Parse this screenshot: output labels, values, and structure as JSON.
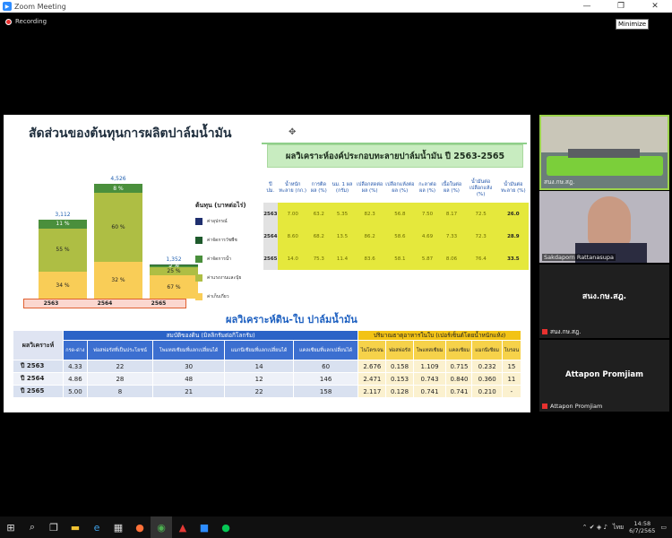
{
  "window": {
    "title": "Zoom Meeting",
    "recording": "Recording",
    "minimize_tip": "Minimize"
  },
  "slide": {
    "title": "สัดส่วนของต้นทุนการผลิตปาล์มน้ำมัน",
    "chart_data": {
      "type": "bar",
      "categories": [
        "2563",
        "2564",
        "2565"
      ],
      "totals": [
        "3,112",
        "4,526",
        "1,352"
      ],
      "legend_title": "ต้นทุน (บาทต่อไร่)",
      "series": [
        {
          "name": "ค่าเก็บเกี่ยว",
          "color": "#f9cd57",
          "values": [
            34,
            32,
            67
          ]
        },
        {
          "name": "ค่าแรงงานและปุ๋ย",
          "color": "#aebe44",
          "values": [
            55,
            60,
            25
          ]
        },
        {
          "name": "ค่าจัดการน้ำ",
          "color": "#4a8f3c",
          "values": [
            11,
            8,
            5
          ]
        },
        {
          "name": "ค่าจัดการวัชพืช",
          "color": "#1e5a2c",
          "values": [
            0,
            0,
            3
          ]
        },
        {
          "name": "ค่าอุปกรณ์",
          "color": "#1f2f6e",
          "values": [
            0,
            0,
            0
          ]
        }
      ]
    },
    "table1": {
      "title": "ผลวิเคราะห์องค์ประกอบทะลายปาล์มน้ำมัน ปี 2563-2565",
      "headers": [
        "ปี ปม.",
        "น้ำหนักทะลาย (กก.)",
        "การติดผล (%)",
        "นม. 1 ผล (กรัม)",
        "เปลือกสดต่อผล (%)",
        "เปลือกแห้งต่อผล (%)",
        "กะลาต่อผล (%)",
        "เนื้อในต่อผล (%)",
        "น้ำมันต่อเปลือกแห้ง (%)",
        "น้ำมันต่อทะลาย (%)"
      ],
      "rows": [
        [
          "2563",
          "7.00",
          "63.2",
          "5.35",
          "82.3",
          "56.8",
          "7.50",
          "8.17",
          "72.5",
          "26.0"
        ],
        [
          "2564",
          "8.60",
          "68.2",
          "13.5",
          "86.2",
          "58.6",
          "4.69",
          "7.33",
          "72.3",
          "28.9"
        ],
        [
          "2565",
          "14.0",
          "75.3",
          "11.4",
          "83.6",
          "58.1",
          "5.87",
          "8.06",
          "76.4",
          "33.5"
        ]
      ]
    },
    "table2": {
      "title": "ผลวิเคราะห์ดิน-ใบ ปาล์มน้ำมัน",
      "corner": "ผลวิเคราะห์",
      "group_soil": "สมบัติของดิน (มิลลิกรัมต่อกิโลกรัม)",
      "group_leaf": "ปริมาณธาตุอาหารในใบ (เปอร์เซ็นต์โดยน้ำหนักแห้ง)",
      "soil_headers": [
        "กรด-ด่าง",
        "ฟอสฟอรัสที่เป็นประโยชน์",
        "โพแทสเซียมที่แลกเปลี่ยนได้",
        "แมกนีเซียมที่แลกเปลี่ยนได้",
        "แคลเซียมที่แลกเปลี่ยนได้"
      ],
      "leaf_headers": [
        "ไนโตรเจน",
        "ฟอสฟอรัส",
        "โพแทสเซียม",
        "แคลเซียม",
        "แมกนีเซียม",
        "โบรอน"
      ],
      "rows": [
        [
          "ปี 2563",
          "4.33",
          "22",
          "30",
          "14",
          "60",
          "2.676",
          "0.158",
          "1.109",
          "0.715",
          "0.232",
          "15"
        ],
        [
          "ปี 2564",
          "4.86",
          "28",
          "48",
          "12",
          "146",
          "2.471",
          "0.153",
          "0.743",
          "0.840",
          "0.360",
          "11"
        ],
        [
          "ปี 2565",
          "5.00",
          "8",
          "21",
          "22",
          "158",
          "2.117",
          "0.128",
          "0.741",
          "0.741",
          "0.210",
          "-"
        ]
      ]
    }
  },
  "participants": [
    {
      "name": "สนง.กษ.สฎ.",
      "type": "video-room"
    },
    {
      "name": "Sakdaporn Rattanasupa",
      "type": "video-person"
    },
    {
      "name": "สนง.กษ.สฎ.",
      "center": "สนง.กษ.สฎ.",
      "type": "name-only"
    },
    {
      "name": "Attapon Promjiam",
      "center": "Attapon Promjiam",
      "type": "name-only"
    }
  ],
  "taskbar": {
    "time": "14:58",
    "date": "6/7/2565",
    "lang": "ไทย"
  }
}
